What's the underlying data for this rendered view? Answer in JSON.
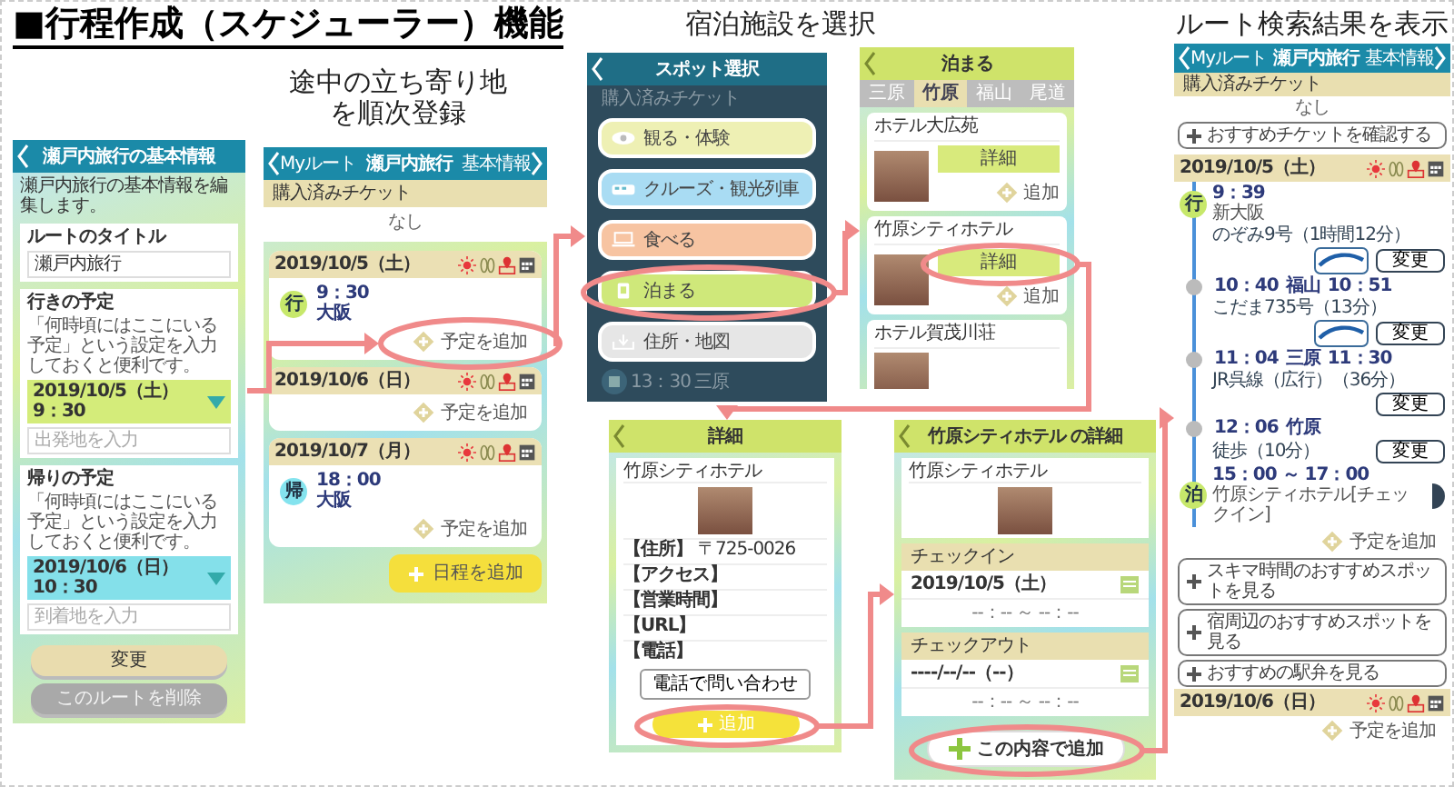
{
  "title": "■行程作成（スケジューラー）機能",
  "captions": [
    {
      "lines": [
        "途中の立ち寄り地",
        "を順次登録"
      ]
    },
    {
      "lines": [
        "宿泊施設を選択"
      ]
    },
    {
      "lines": [
        "ルート検索結果を表示"
      ]
    }
  ],
  "basic_info": {
    "header": "瀬戸内旅行の基本情報",
    "intro": "瀬戸内旅行の基本情報を編集します。",
    "sections": [
      {
        "kind": "title",
        "heading": "ルートのタイトル",
        "value": "瀬戸内旅行"
      },
      {
        "kind": "plan",
        "heading": "行きの予定",
        "note": "「何時頃にはここにいる予定」という設定を入力しておくと便利です。",
        "datetime": "2019/10/5（土） 9：30",
        "color": "#d4ec7a",
        "placeholder": "出発地を入力"
      },
      {
        "kind": "plan",
        "heading": "帰りの予定",
        "note": "「何時頃にはここにいる予定」という設定を入力しておくと便利です。",
        "datetime": "2019/10/6（日） 10：30",
        "color": "#84e0ea",
        "placeholder": "到着地を入力"
      }
    ],
    "buttons": [
      {
        "label": "変更",
        "disabled": false
      },
      {
        "label": "このルートを削除",
        "disabled": true
      }
    ]
  },
  "schedule": {
    "header": {
      "back": "Myルート",
      "title": "瀬戸内旅行",
      "forward": "基本情報"
    },
    "tickets": {
      "heading": "購入済みチケット",
      "empty": "なし"
    },
    "days": [
      {
        "date": "2019/10/5（土）",
        "entries": [
          {
            "badge": "行",
            "color": "#c7e86b",
            "time": "9：30",
            "place": "大阪"
          }
        ],
        "add": {
          "label": "予定を追加",
          "highlighted": true
        }
      },
      {
        "date": "2019/10/6（日）",
        "add": {
          "label": "予定を追加",
          "highlighted": false
        }
      },
      {
        "date": "2019/10/7（月）",
        "entries": [
          {
            "badge": "帰",
            "color": "#84e3ee",
            "time": "18：00",
            "place": "大阪"
          }
        ],
        "add": {
          "label": "予定を追加",
          "highlighted": false
        }
      }
    ],
    "add_day": "日程を追加"
  },
  "spot_select": {
    "header": "スポット選択",
    "behind_top": "購入済みチケット",
    "options": [
      {
        "label": "観る・体験",
        "kind": "eye",
        "color": "#eef0b4",
        "selected": false
      },
      {
        "label": "クルーズ・観光列車",
        "kind": "train",
        "color": "#a9dcf3",
        "selected": false
      },
      {
        "label": "食べる",
        "kind": "food",
        "color": "#f7c4a2",
        "selected": false
      },
      {
        "label": "泊まる",
        "kind": "stay",
        "color": "#cfe87a",
        "selected": true
      },
      {
        "label": "住所・地図",
        "kind": "map",
        "color": "#e6e6e6",
        "selected": false
      }
    ],
    "behind_bottom": {
      "time": "13：30",
      "place": "三原"
    }
  },
  "lodging_list": {
    "header": "泊まる",
    "tabs": [
      {
        "label": "三原",
        "selected": false
      },
      {
        "label": "竹原",
        "selected": true
      },
      {
        "label": "福山",
        "selected": false
      },
      {
        "label": "尾道",
        "selected": false
      }
    ],
    "hotels": [
      {
        "name": "ホテル大広苑",
        "detail": "詳細",
        "add": "追加",
        "highlighted": false
      },
      {
        "name": "竹原シティホテル",
        "detail": "詳細",
        "add": "追加",
        "highlighted": true
      },
      {
        "name": "ホテル賀茂川荘"
      }
    ]
  },
  "facility_detail": {
    "header": "詳細",
    "name": "竹原シティホテル",
    "fields": [
      {
        "label": "【住所】",
        "value": "〒725-0026"
      },
      {
        "label": "【アクセス】"
      },
      {
        "label": "【営業時間】"
      },
      {
        "label": "【URL】"
      },
      {
        "label": "【電話】"
      }
    ],
    "contact": "電話で問い合わせ",
    "add": {
      "label": "追加",
      "highlighted": true
    }
  },
  "hotel_detail": {
    "header": "竹原シティホテル の詳細",
    "name": "竹原シティホテル",
    "sections": [
      {
        "heading": "チェックイン",
        "date": "2019/10/5（土）",
        "time": "--：-- ～ --：--"
      },
      {
        "heading": "チェックアウト",
        "date": "----/--/--（--）",
        "time": "--：-- ～ --：--"
      }
    ],
    "submit": {
      "label": "この内容で追加",
      "highlighted": true
    }
  },
  "route_result": {
    "header": {
      "back": "Myルート",
      "title": "瀬戸内旅行",
      "forward": "基本情報"
    },
    "tickets": {
      "heading": "購入済みチケット",
      "empty": "なし"
    },
    "recommend_ticket": "おすすめチケットを確認する",
    "days": [
      {
        "date": "2019/10/5（土）",
        "timeline": [
          {
            "kind": "endpoint",
            "badge": "行",
            "color": "#c7e86b",
            "lines": [
              "9：39",
              "新大阪"
            ],
            "has_detail": false
          },
          {
            "kind": "leg",
            "label": "のぞみ9号（1時間12分）",
            "logo": true,
            "button": "変更"
          },
          {
            "kind": "stop",
            "lines": [
              "10：40",
              "福山",
              "10：51"
            ]
          },
          {
            "kind": "leg",
            "label": "こだま735号（13分）",
            "logo": true,
            "button": "変更"
          },
          {
            "kind": "stop",
            "lines": [
              "11：04",
              "三原",
              "11：30"
            ]
          },
          {
            "kind": "leg",
            "label": "JR呉線（広行）（36分）",
            "logo": false,
            "button": "変更"
          },
          {
            "kind": "stop",
            "lines": [
              "12：06",
              "竹原"
            ]
          },
          {
            "kind": "leg",
            "label": "徒歩（10分）",
            "logo": false,
            "button": "変更"
          },
          {
            "kind": "endpoint",
            "badge": "泊",
            "color": "#c7e86b",
            "lines": [
              "15：00 ～ 17：00",
              "竹原シティホテル[チェックイン]"
            ],
            "has_detail": true
          }
        ],
        "add": "予定を追加",
        "recommendations": [
          "スキマ時間のおすすめスポットを見る",
          "宿周辺のおすすめスポットを見る",
          "おすすめの駅弁を見る"
        ]
      },
      {
        "date": "2019/10/6（日）",
        "add": "予定を追加"
      }
    ]
  }
}
